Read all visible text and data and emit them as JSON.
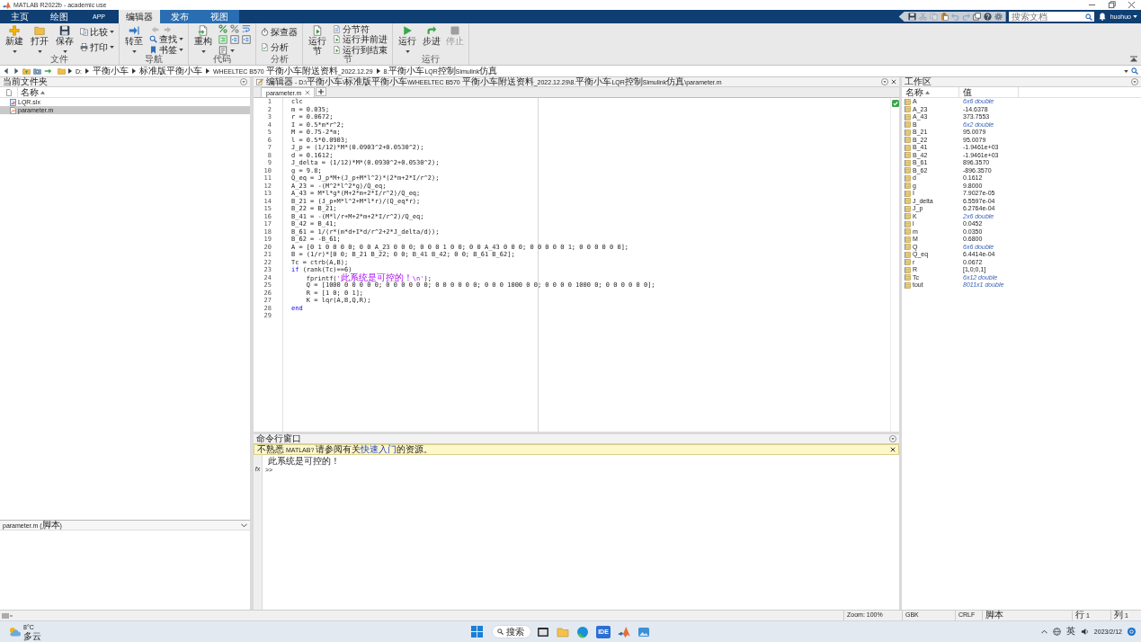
{
  "window": {
    "title": "MATLAB R2022b - academic use"
  },
  "toolstrip": {
    "tabs": [
      {
        "label": "主页",
        "selected": false,
        "contextual": false
      },
      {
        "label": "绘图",
        "selected": false,
        "contextual": false
      },
      {
        "label": "APP",
        "selected": false,
        "contextual": false
      },
      {
        "label": "编辑器",
        "selected": true,
        "contextual": true
      },
      {
        "label": "发布",
        "selected": false,
        "contextual": true
      },
      {
        "label": "视图",
        "selected": false,
        "contextual": true
      }
    ],
    "quick_access": [
      {
        "disabled": false
      },
      {
        "disabled": true
      },
      {
        "disabled": true
      },
      {
        "disabled": false
      },
      {
        "disabled": true
      },
      {
        "disabled": true
      },
      {
        "disabled": false
      },
      {
        "disabled": false
      },
      {
        "disabled": false
      }
    ],
    "search": {
      "placeholder": "搜索文档"
    },
    "user": "huohuo"
  },
  "ribbon": {
    "groups": [
      {
        "label": "文件",
        "controls": [
          {
            "kind": "large",
            "label": "新建",
            "menu": true
          },
          {
            "kind": "large",
            "label": "打开",
            "menu": true
          },
          {
            "kind": "large",
            "label": "保存",
            "menu": true
          },
          {
            "kind": "column",
            "controls": [
              {
                "kind": "small",
                "label": "比较",
                "menu": true
              },
              {
                "kind": "small",
                "label": "打印",
                "menu": true
              }
            ]
          }
        ]
      },
      {
        "label": "导航",
        "controls": [
          {
            "kind": "large",
            "label": "转至",
            "menu": true
          },
          {
            "kind": "column",
            "controls": [
              {
                "kind": "arrows",
                "items": [
                  {
                    "disabled": true
                  },
                  {
                    "disabled": true
                  }
                ]
              },
              {
                "kind": "small",
                "label": "查找",
                "menu": true
              },
              {
                "kind": "small",
                "label": "书签",
                "menu": true
              }
            ]
          }
        ]
      },
      {
        "label": "代码",
        "controls": [
          {
            "kind": "large",
            "label": "重构",
            "menu": true
          },
          {
            "kind": "icon_grid"
          }
        ]
      },
      {
        "label": "分析",
        "controls": [
          {
            "kind": "column",
            "controls": [
              {
                "kind": "small",
                "label": "探查器",
                "menu": false
              },
              {
                "kind": "small",
                "label": "分析",
                "menu": false
              }
            ]
          }
        ]
      },
      {
        "label": "节",
        "controls": [
          {
            "kind": "large",
            "label": "运行节",
            "menu": false
          },
          {
            "kind": "column",
            "controls": [
              {
                "kind": "small",
                "label": "分节符",
                "menu": false
              },
              {
                "kind": "small",
                "label": "运行并前进",
                "menu": false
              },
              {
                "kind": "small",
                "label": "运行到结束",
                "menu": false
              }
            ]
          }
        ]
      },
      {
        "label": "运行",
        "controls": [
          {
            "kind": "large",
            "label": "运行",
            "menu": true,
            "disabled": false
          },
          {
            "kind": "large",
            "label": "步进",
            "menu": false,
            "disabled": false
          },
          {
            "kind": "large",
            "label": "停止",
            "menu": false,
            "disabled": true
          }
        ]
      }
    ]
  },
  "address_bar": {
    "path": [
      "D:",
      "平衡小车",
      "标准版平衡小车",
      "WHEELTEC B570 平衡小车附送资料_2022.12.29",
      "8.平衡小车LQR控制Simulink仿真"
    ]
  },
  "current_folder": {
    "title": "当前文件夹",
    "column": "名称",
    "sorted": true,
    "files": [
      {
        "name": "LQR.slx",
        "kind": "model",
        "selected": false
      },
      {
        "name": "parameter.m",
        "kind": "script",
        "selected": true
      }
    ],
    "details": "parameter.m  (脚本)"
  },
  "editor": {
    "title": "编辑器 - D:\\平衡小车\\标准版平衡小车\\WHEELTEC B570 平衡小车附送资料_2022.12.29\\8.平衡小车LQR控制Simulink仿真\\parameter.m",
    "tabs": [
      {
        "label": "parameter.m",
        "selected": true
      }
    ],
    "checks_passed": true,
    "lines": [
      {
        "number": "1",
        "segments": [
          {
            "kind": "plain",
            "text": "clc"
          }
        ]
      },
      {
        "number": "2",
        "segments": [
          {
            "kind": "plain",
            "text": "m = 0.035;"
          }
        ]
      },
      {
        "number": "3",
        "segments": [
          {
            "kind": "plain",
            "text": "r = 0.0672;"
          }
        ]
      },
      {
        "number": "4",
        "segments": [
          {
            "kind": "plain",
            "text": "I = 0.5*m*r^2;"
          }
        ]
      },
      {
        "number": "5",
        "segments": [
          {
            "kind": "plain",
            "text": "M = 0.75-2*m;"
          }
        ]
      },
      {
        "number": "6",
        "segments": [
          {
            "kind": "plain",
            "text": "l = 0.5*0.0903;"
          }
        ]
      },
      {
        "number": "7",
        "segments": [
          {
            "kind": "plain",
            "text": "J_p = (1/12)*M*(0.0903^2+0.0530^2);"
          }
        ]
      },
      {
        "number": "8",
        "segments": [
          {
            "kind": "plain",
            "text": "d = 0.1612;"
          }
        ]
      },
      {
        "number": "9",
        "segments": [
          {
            "kind": "plain",
            "text": "J_delta = (1/12)*M*(0.0930^2+0.0530^2);"
          }
        ]
      },
      {
        "number": "10",
        "segments": [
          {
            "kind": "plain",
            "text": "g = 9.8;"
          }
        ]
      },
      {
        "number": "11",
        "segments": [
          {
            "kind": "plain",
            "text": "Q_eq = J_p*M+(J_p+M*l^2)*(2*m+2*I/r^2);"
          }
        ]
      },
      {
        "number": "12",
        "segments": [
          {
            "kind": "plain",
            "text": "A_23 = -(M^2*l^2*g)/Q_eq;"
          }
        ]
      },
      {
        "number": "13",
        "segments": [
          {
            "kind": "plain",
            "text": "A_43 = M*l*g*(M+2*m+2*I/r^2)/Q_eq;"
          }
        ]
      },
      {
        "number": "14",
        "segments": [
          {
            "kind": "plain",
            "text": "B_21 = (J_p+M*l^2+M*l*r)/(Q_eq*r);"
          }
        ]
      },
      {
        "number": "15",
        "segments": [
          {
            "kind": "plain",
            "text": "B_22 = B_21;"
          }
        ]
      },
      {
        "number": "16",
        "segments": [
          {
            "kind": "plain",
            "text": "B_41 = -(M*l/r+M+2*m+2*I/r^2)/Q_eq;"
          }
        ]
      },
      {
        "number": "17",
        "segments": [
          {
            "kind": "plain",
            "text": "B_42 = B_41;"
          }
        ]
      },
      {
        "number": "18",
        "segments": [
          {
            "kind": "plain",
            "text": "B_61 = 1/(r*(m*d+I*d/r^2+2*J_delta/d));"
          }
        ]
      },
      {
        "number": "19",
        "segments": [
          {
            "kind": "plain",
            "text": "B_62 = -B_61;"
          }
        ]
      },
      {
        "number": "20",
        "segments": [
          {
            "kind": "plain",
            "text": "A = [0 1 0 0 0 0; 0 0 A_23 0 0 0; 0 0 0 1 0 0; 0 0 A_43 0 0 0; 0 0 0 0 0 1; 0 0 0 0 0 0];"
          }
        ]
      },
      {
        "number": "21",
        "segments": [
          {
            "kind": "plain",
            "text": "B = (1/r)*[0 0; B_21 B_22; 0 0; B_41 B_42; 0 0; B_61 B_62];"
          }
        ]
      },
      {
        "number": "22",
        "segments": [
          {
            "kind": "plain",
            "text": "Tc = ctrb(A,B);"
          }
        ]
      },
      {
        "number": "23",
        "segments": [
          {
            "kind": "keyword",
            "text": "if"
          },
          {
            "kind": "plain",
            "text": " (rank(Tc)==6)"
          }
        ]
      },
      {
        "number": "24",
        "segments": [
          {
            "kind": "plain",
            "text": "    fprintf("
          },
          {
            "kind": "string",
            "text": "'此系统是可控的！\\n'"
          },
          {
            "kind": "plain",
            "text": ");"
          }
        ]
      },
      {
        "number": "25",
        "segments": [
          {
            "kind": "plain",
            "text": "    Q = [1000 0 0 0 0 0; 0 0 0 0 0 0; 0 0 0 0 0 0; 0 0 0 1000 0 0; 0 0 0 0 1000 0; 0 0 0 0 0 0];"
          }
        ]
      },
      {
        "number": "26",
        "segments": [
          {
            "kind": "plain",
            "text": "    R = [1 0; 0 1];"
          }
        ]
      },
      {
        "number": "27",
        "segments": [
          {
            "kind": "plain",
            "text": "    K = lqr(A,B,Q,R);"
          }
        ]
      },
      {
        "number": "28",
        "segments": [
          {
            "kind": "keyword",
            "text": "end"
          }
        ]
      },
      {
        "number": "29"
      }
    ]
  },
  "command_window": {
    "title": "命令行窗口",
    "banner": {
      "before": "不熟悉 MATLAB? 请参阅有关",
      "link": "快速入门",
      "after": "的资源。"
    },
    "output": [
      "此系统是可控的！"
    ],
    "function_button": "fx",
    "prompt": ">>"
  },
  "workspace": {
    "title": "工作区",
    "columns": [
      "名称",
      "值"
    ],
    "sorted": true,
    "variables": [
      {
        "name": "A",
        "value": "6x6 double",
        "kind": "size"
      },
      {
        "name": "A_23",
        "value": "-14.6378",
        "kind": "value"
      },
      {
        "name": "A_43",
        "value": "373.7553",
        "kind": "value"
      },
      {
        "name": "B",
        "value": "6x2 double",
        "kind": "size"
      },
      {
        "name": "B_21",
        "value": "95.0079",
        "kind": "value"
      },
      {
        "name": "B_22",
        "value": "95.0079",
        "kind": "value"
      },
      {
        "name": "B_41",
        "value": "-1.9461e+03",
        "kind": "value"
      },
      {
        "name": "B_42",
        "value": "-1.9461e+03",
        "kind": "value"
      },
      {
        "name": "B_61",
        "value": "896.3570",
        "kind": "value"
      },
      {
        "name": "B_62",
        "value": "-896.3570",
        "kind": "value"
      },
      {
        "name": "d",
        "value": "0.1612",
        "kind": "value"
      },
      {
        "name": "g",
        "value": "9.8000",
        "kind": "value"
      },
      {
        "name": "I",
        "value": "7.9027e-05",
        "kind": "value"
      },
      {
        "name": "J_delta",
        "value": "6.5597e-04",
        "kind": "value"
      },
      {
        "name": "J_p",
        "value": "6.2764e-04",
        "kind": "value"
      },
      {
        "name": "K",
        "value": "2x6 double",
        "kind": "size"
      },
      {
        "name": "l",
        "value": "0.0452",
        "kind": "value"
      },
      {
        "name": "m",
        "value": "0.0350",
        "kind": "value"
      },
      {
        "name": "M",
        "value": "0.6800",
        "kind": "value"
      },
      {
        "name": "Q",
        "value": "6x6 double",
        "kind": "size"
      },
      {
        "name": "Q_eq",
        "value": "6.4414e-04",
        "kind": "value"
      },
      {
        "name": "r",
        "value": "0.0672",
        "kind": "value"
      },
      {
        "name": "R",
        "value": "[1,0;0,1]",
        "kind": "value"
      },
      {
        "name": "Tc",
        "value": "6x12 double",
        "kind": "size"
      },
      {
        "name": "tout",
        "value": "8011x1 double",
        "kind": "size"
      }
    ]
  },
  "status_bar": {
    "zoom": "Zoom: 100%",
    "encoding": "GBK",
    "line_ending": "CRLF",
    "file_type": "脚本",
    "line": "行 1",
    "column": "列 1"
  },
  "taskbar": {
    "weather": {
      "temperature": "8°C",
      "condition": "多云"
    },
    "search": "搜索",
    "app_label": "IDE",
    "input_method": "英",
    "date": "2023/2/12"
  }
}
